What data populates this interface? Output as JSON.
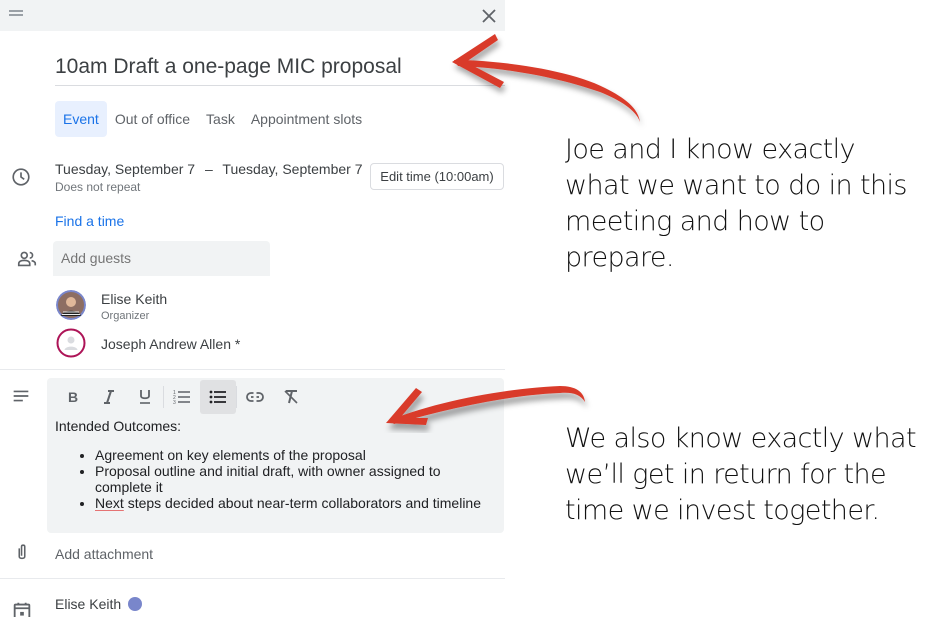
{
  "window": {
    "drag_icon": "drag-handle-icon",
    "close_icon": "close-icon"
  },
  "event": {
    "title": "10am Draft a one-page MIC proposal",
    "tabs": [
      {
        "label": "Event",
        "active": true
      },
      {
        "label": "Out of office",
        "active": false
      },
      {
        "label": "Task",
        "active": false
      },
      {
        "label": "Appointment slots",
        "active": false
      }
    ],
    "start_date": "Tuesday, September 7",
    "date_separator": "–",
    "end_date": "Tuesday, September 7",
    "repeat": "Does not repeat",
    "edit_time_label": "Edit time (10:00am)",
    "find_time_label": "Find a time",
    "guests_placeholder": "Add guests",
    "guests": [
      {
        "name": "Elise Keith",
        "role": "Organizer",
        "ring_color": "#7986cb"
      },
      {
        "name": "Joseph Andrew Allen *",
        "role": "",
        "ring_color": "#ad1457"
      }
    ],
    "description": {
      "toolbar": [
        {
          "name": "bold",
          "glyph": "B"
        },
        {
          "name": "italic",
          "glyph": "I"
        },
        {
          "name": "underline",
          "glyph": "U"
        },
        {
          "name": "numbered-list"
        },
        {
          "name": "bulleted-list",
          "active": true
        },
        {
          "name": "link"
        },
        {
          "name": "remove-formatting"
        }
      ],
      "heading": "Intended Outcomes:",
      "bullets": [
        "Agreement on key elements of the proposal",
        "Proposal outline and initial draft, with owner assigned to complete it",
        "steps decided about near-term collaborators and timeline"
      ],
      "misspelled_word": "Next"
    },
    "attachment_label": "Add attachment",
    "calendar_owner": "Elise Keith",
    "calendar_color": "#7986cb"
  },
  "annotations": {
    "top": [
      "Joe and I know exactly",
      "what we want to do in this",
      "meeting and how to",
      "prepare."
    ],
    "bottom": [
      "We also know exactly what",
      "we’ll get in return for the",
      "time we invest together."
    ],
    "arrow_color": "#d93a2b"
  },
  "colors": {
    "accent": "#1a73e8",
    "active_tab_bg": "#e8f0fe",
    "panel_bg": "#f1f3f4"
  }
}
